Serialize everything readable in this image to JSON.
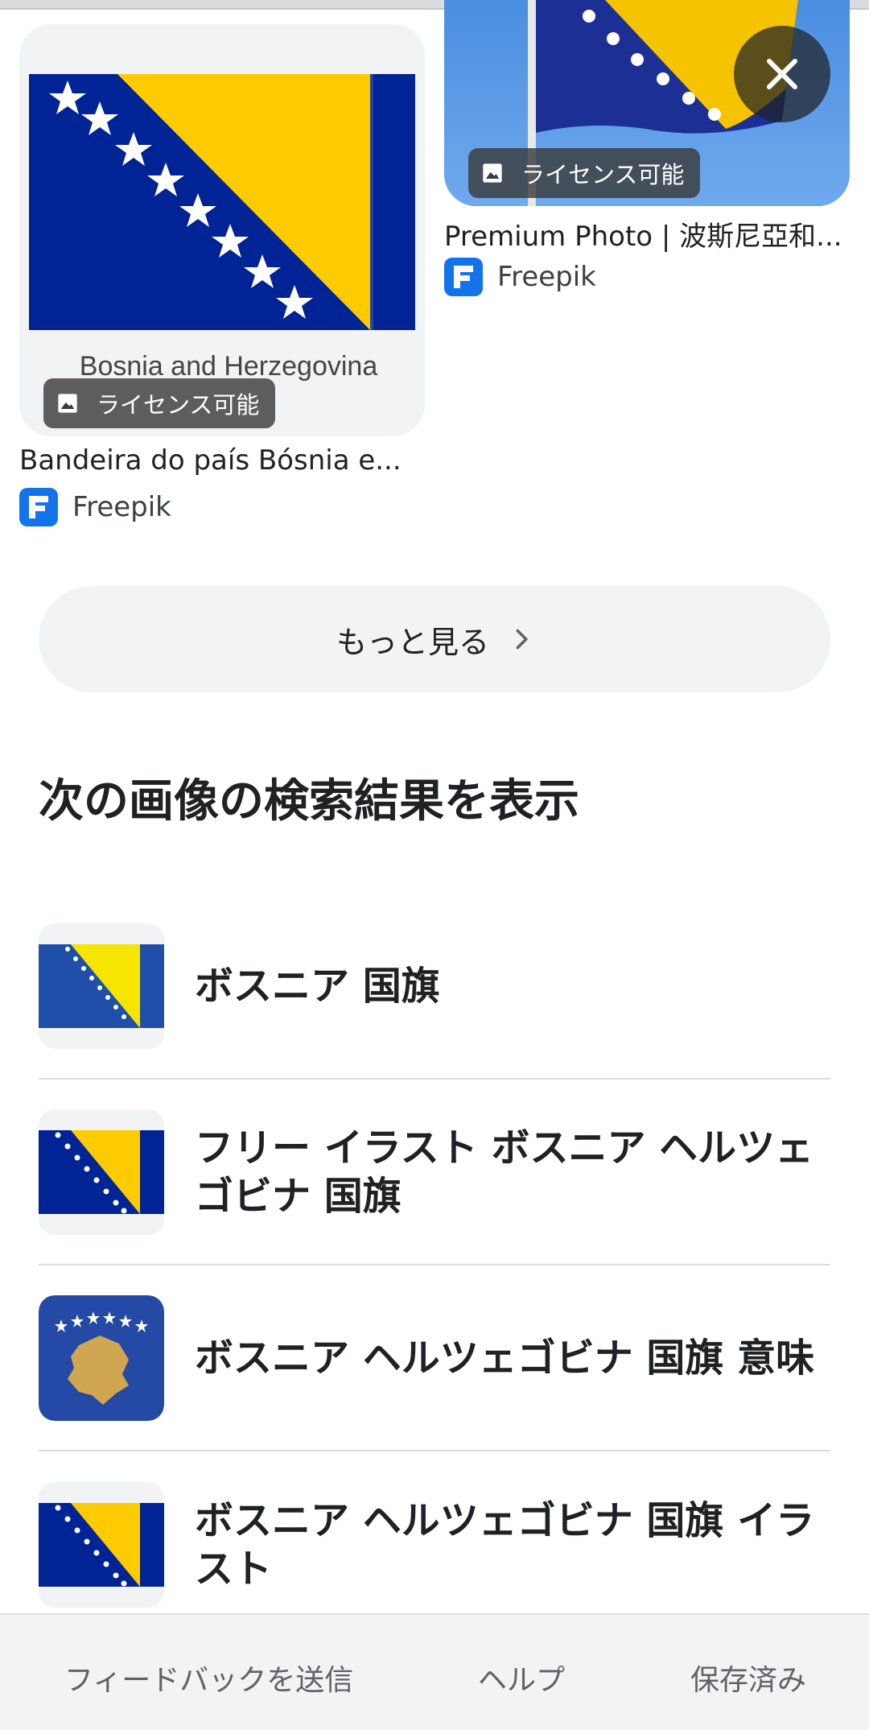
{
  "results": [
    {
      "badge": "ライセンス可能",
      "flag_caption": "Bosnia and Herzegovina",
      "title": "Bandeira do país Bósnia e...",
      "source": "Freepik"
    },
    {
      "badge": "ライセンス可能",
      "title": "Premium Photo | 波斯尼亞和...",
      "source": "Freepik"
    }
  ],
  "more_button": {
    "label": "もっと見る"
  },
  "related": {
    "title": "次の画像の検索結果を表示",
    "items": [
      {
        "label": "ボスニア 国旗",
        "thumb": "flag-bosnia-icon"
      },
      {
        "label": "フリー イラスト ボスニア ヘルツェゴビナ 国旗",
        "thumb": "flag-bosnia-icon"
      },
      {
        "label": "ボスニア ヘルツェゴビナ 国旗 意味",
        "thumb": "flag-kosovo-icon"
      },
      {
        "label": "ボスニア ヘルツェゴビナ 国旗 イラスト",
        "thumb": "flag-bosnia-icon"
      }
    ]
  },
  "footer": {
    "feedback": "フィードバックを送信",
    "help": "ヘルプ",
    "saved": "保存済み"
  },
  "colors": {
    "flag_blue": "#002395",
    "flag_yellow": "#FECB00",
    "kosovo_blue": "#244AA5",
    "kosovo_gold": "#D0A650",
    "freepik_blue": "#1273EB"
  }
}
